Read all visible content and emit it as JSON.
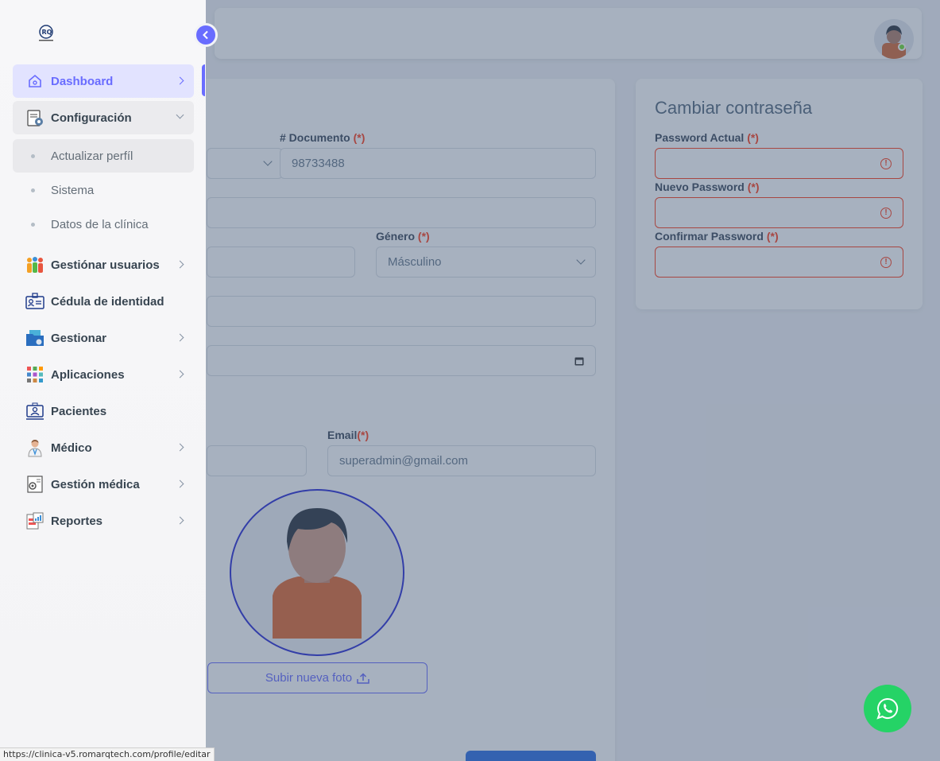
{
  "sidebar": {
    "items": [
      {
        "label": "Dashboard",
        "icon": "home-icon"
      },
      {
        "label": "Configuración",
        "icon": "settings-notepad-icon"
      },
      {
        "label": "Gestiónar usuarios",
        "icon": "users-group-icon"
      },
      {
        "label": "Cédula de identidad",
        "icon": "id-card-icon"
      },
      {
        "label": "Gestionar",
        "icon": "folder-gear-icon"
      },
      {
        "label": "Aplicaciones",
        "icon": "apps-grid-icon"
      },
      {
        "label": "Pacientes",
        "icon": "patient-monitor-icon"
      },
      {
        "label": "Médico",
        "icon": "doctor-icon"
      },
      {
        "label": "Gestión médica",
        "icon": "medical-document-icon"
      },
      {
        "label": "Reportes",
        "icon": "report-chart-icon"
      }
    ],
    "submenu": [
      {
        "label": "Actualizar perfíl"
      },
      {
        "label": "Sistema"
      },
      {
        "label": "Datos de la clínica"
      }
    ]
  },
  "profile": {
    "document_label": "# Documento",
    "document_value": "98733488",
    "gender_label": "Género",
    "gender_value": "Másculino",
    "email_label": "Email",
    "email_value": "superadmin@gmail.com",
    "required_mark": "(*)",
    "upload_label": "Subir nueva foto"
  },
  "password": {
    "title": "Cambiar contraseña",
    "current_label": "Password Actual",
    "new_label": "Nuevo Password",
    "confirm_label": "Confirmar Password",
    "required_mark": "(*)"
  },
  "status_bar": {
    "url": "https://clinica-v5.romarqtech.com/profile/editar"
  },
  "colors": {
    "accent": "#696cff",
    "error": "#ff3e1d",
    "whatsapp": "#25d366"
  }
}
